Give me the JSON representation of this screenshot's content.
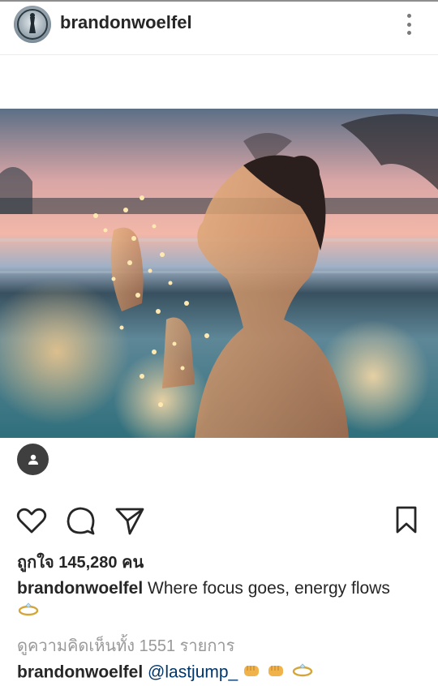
{
  "post": {
    "username": "brandonwoelfel",
    "likes_text": "ถูกใจ 145,280 คน",
    "caption_username": "brandonwoelfel",
    "caption_text": "Where focus goes, energy flows",
    "view_comments_text": "ดูความคิดเห็นทั้ง 1551 รายการ",
    "comment": {
      "username": "brandonwoelfel",
      "mention": "@lastjump_"
    }
  },
  "icons": {
    "more": "more-vertical-icon",
    "user_tag": "person-icon",
    "like": "heart-icon",
    "comment": "comment-bubble-icon",
    "share": "paper-plane-icon",
    "save": "bookmark-icon"
  },
  "colors": {
    "text": "#262626",
    "muted": "#999999",
    "mention": "#003569",
    "tag_button": "#3f3f3f"
  }
}
